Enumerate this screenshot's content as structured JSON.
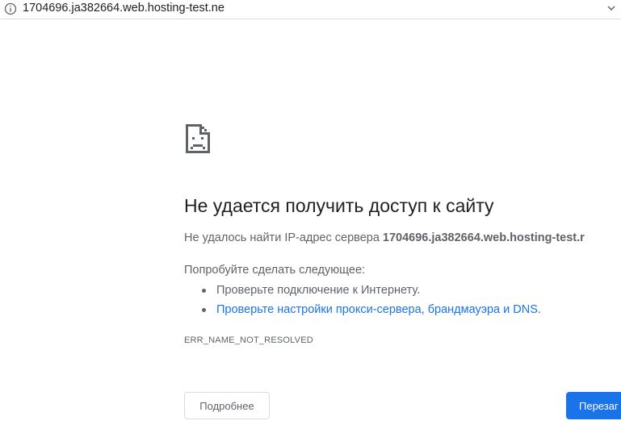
{
  "browser": {
    "url": "1704696.ja382664.web.hosting-test.ne"
  },
  "error_page": {
    "title": "Не удается получить доступ к сайту",
    "summary_prefix": "Не удалось найти IP-адрес сервера ",
    "summary_host": "1704696.ja382664.web.hosting-test.r",
    "suggestions_heading": "Попробуйте сделать следующее:",
    "suggestions": [
      {
        "text": "Проверьте подключение к Интернету.",
        "is_link": false
      },
      {
        "text": "Проверьте настройки прокси-сервера, брандмауэра и DNS",
        "is_link": true,
        "suffix": "."
      }
    ],
    "error_code": "ERR_NAME_NOT_RESOLVED",
    "details_label": "Подробнее",
    "reload_label": "Перезаг"
  },
  "colors": {
    "link": "#1a73e8",
    "primary_button": "#1a73e8",
    "text_secondary": "#5f6368",
    "title": "#202124"
  },
  "icons": {
    "address_info": "info-circle-icon",
    "address_menu": "chevron-down-icon",
    "error": "sad-page-icon"
  }
}
